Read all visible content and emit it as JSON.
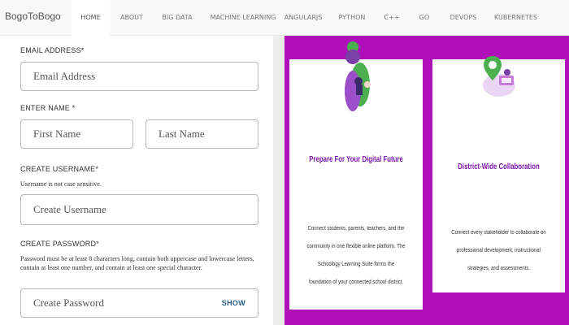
{
  "navbar": {
    "brand": "BogoToBogo",
    "items": [
      "HOME",
      "ABOUT",
      "BIG DATA",
      "MACHINE LEARNING",
      "ANGULARJS",
      "PYTHON",
      "C++",
      "GO",
      "DEVOPS",
      "KUBERNETES"
    ],
    "active": "HOME"
  },
  "form": {
    "email": {
      "label": "EMAIL ADDRESS*",
      "placeholder": "Email Address"
    },
    "name": {
      "label": "ENTER NAME *",
      "first_placeholder": "First Name",
      "last_placeholder": "Last Name"
    },
    "username": {
      "label": "CREATE USERNAME*",
      "help": "Username is not case sensitive.",
      "placeholder": "Create Username"
    },
    "password": {
      "label": "CREATE PASSWORD*",
      "help": "Password must be at least 8 characters long, contain both uppercase and lowercase letters, contain at least one number, and contain at least one special character.",
      "placeholder": "Create Password",
      "show_label": "SHOW"
    }
  },
  "promo": {
    "background_color": "#b010b8",
    "cards": [
      {
        "title": "Prepare For Your Digital Future",
        "text": "Connect students, parents, teachers, and the community in one flexible online platform. The Schoology Learning Suite forms the foundation of your connected school district.",
        "icon": "digital-future-illustration"
      },
      {
        "title": "District-Wide Collaboration",
        "text": "Connect every stakeholder to collaborate on professional development, instructional strategies, and assessments.",
        "icon": "collaboration-illustration"
      }
    ]
  }
}
